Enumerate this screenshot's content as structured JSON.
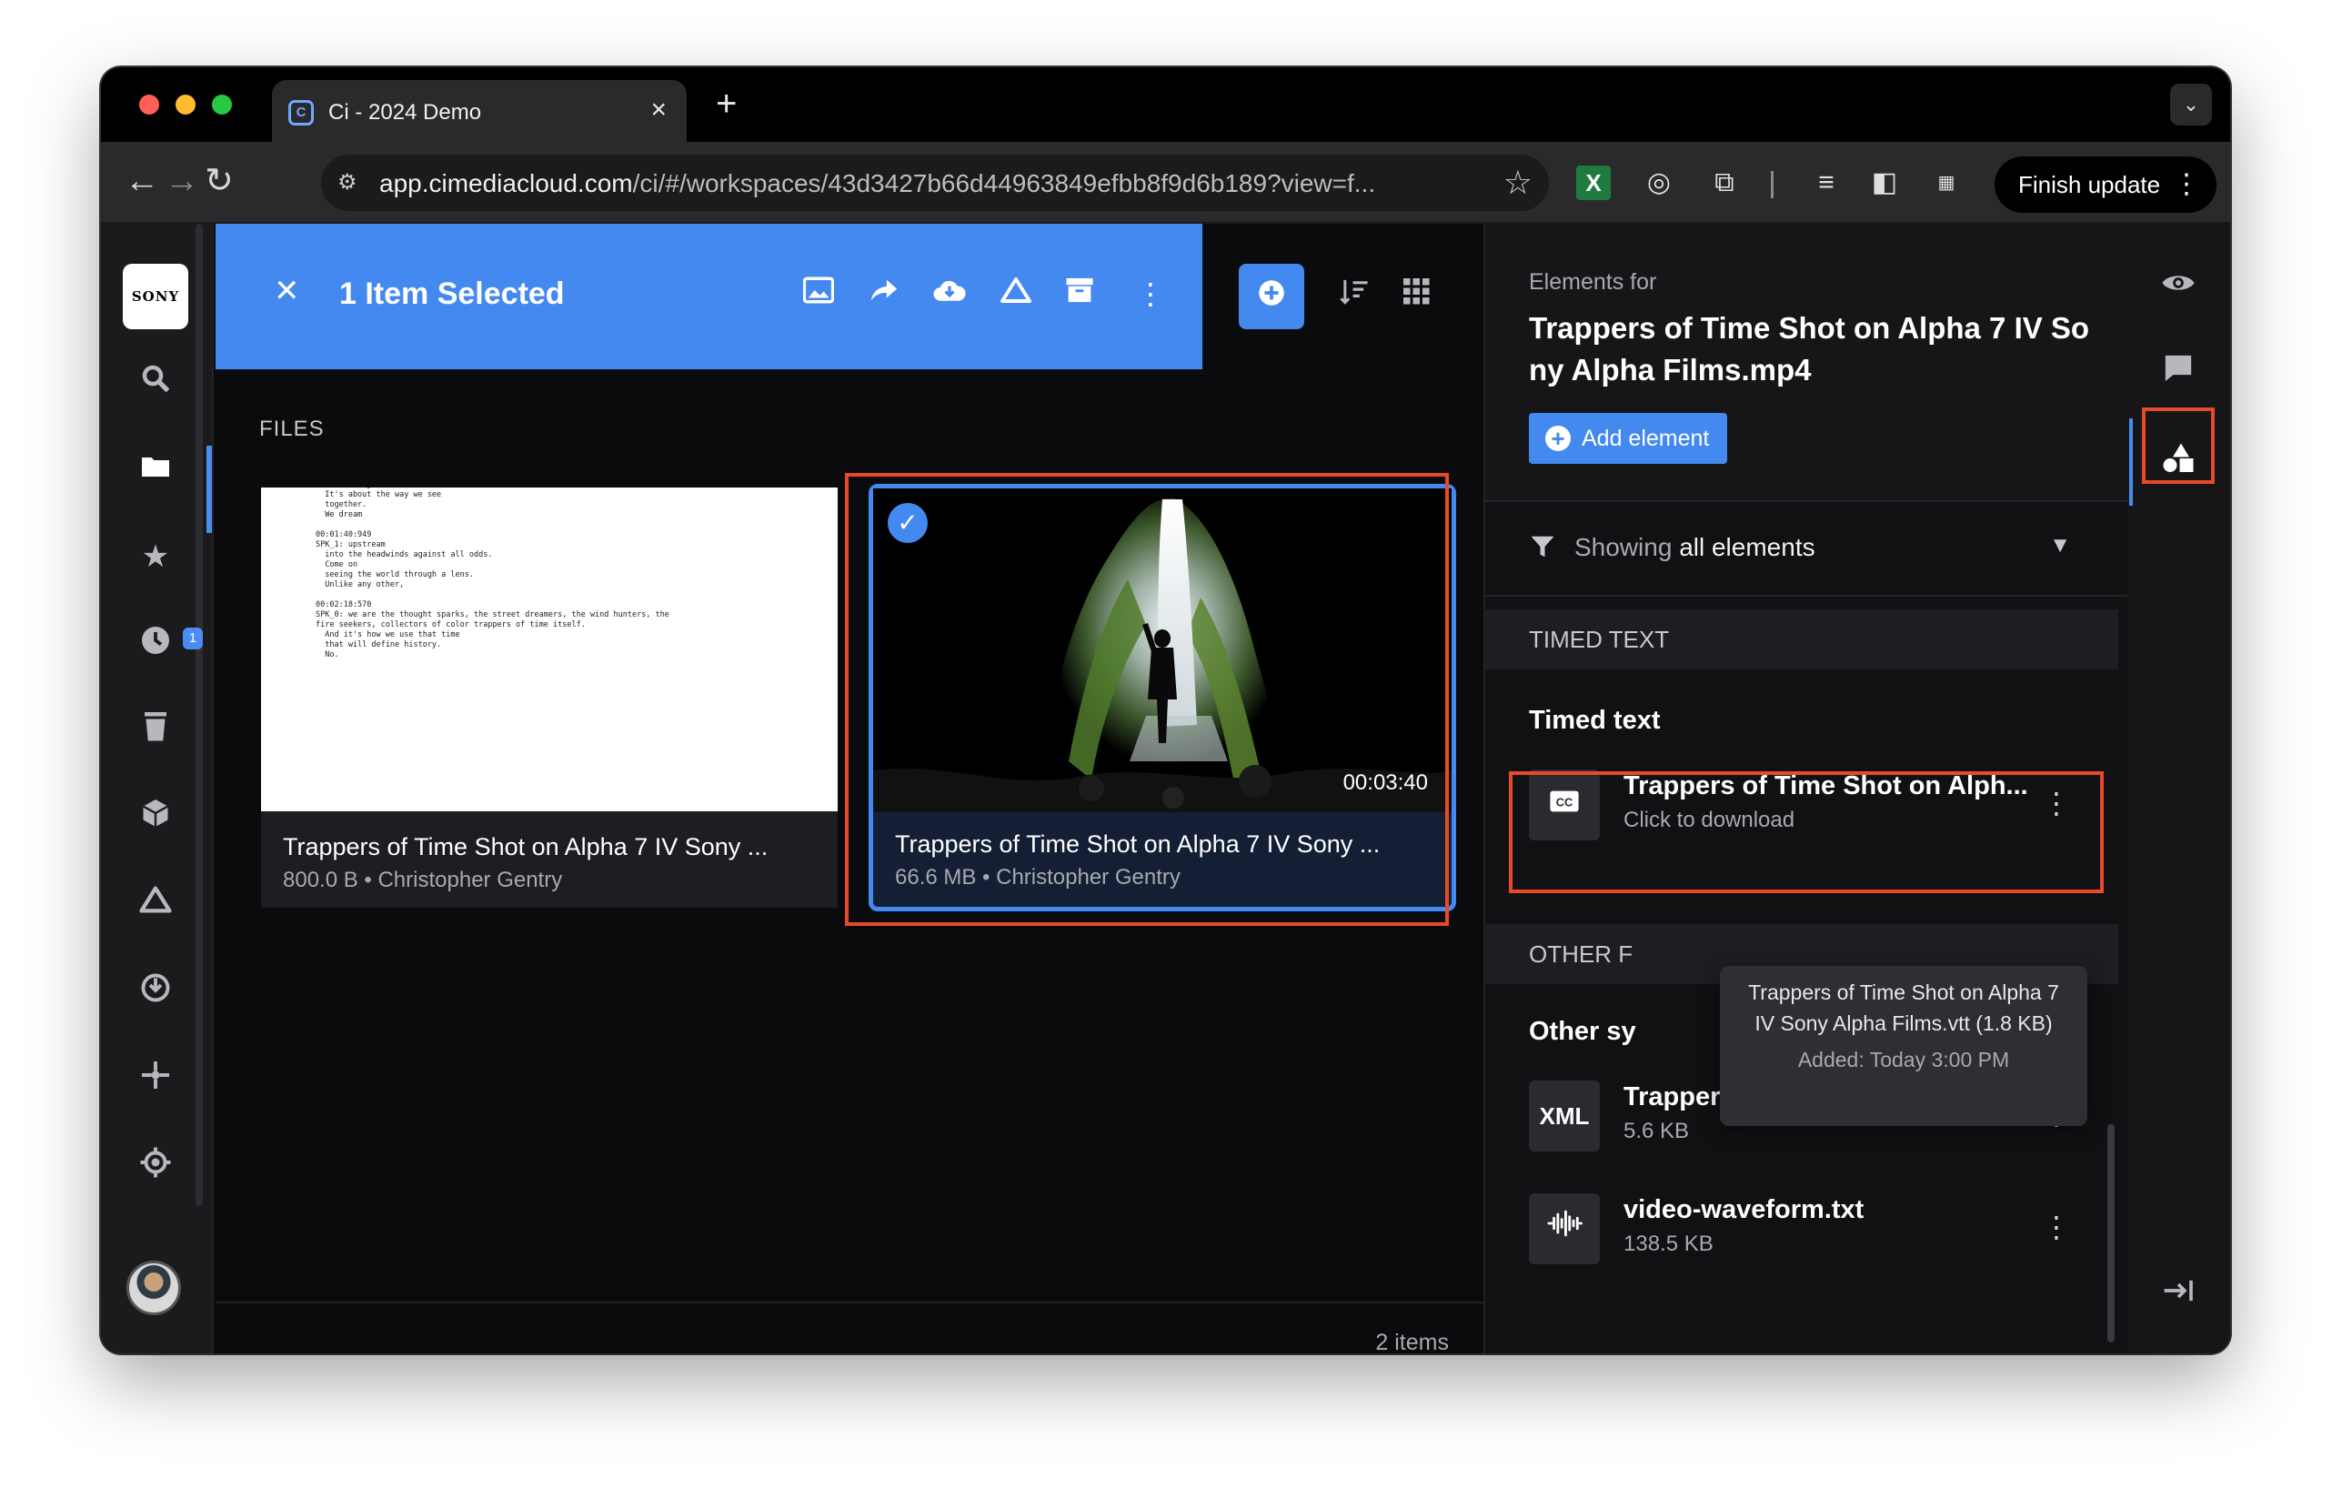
{
  "browser": {
    "tab_title": "Ci - 2024 Demo",
    "tab_favicon": "C",
    "url_domain": "app.cimediacloud.com",
    "url_path": "/ci/#/workspaces/43d3427b66d44963849efbb8f9d6b189?view=f...",
    "finish_update_label": "Finish update",
    "icons": [
      "back-icon",
      "forward-icon",
      "reload-icon",
      "site-settings-icon",
      "star-icon",
      "excel-extension-icon",
      "grammar-extension-icon",
      "puzzle-extension-icon",
      "media-control-icon",
      "sidepanel-icon",
      "sony-extension-icon"
    ]
  },
  "leftnav": {
    "logo_text": "SONY",
    "badge_count": "1",
    "items": [
      "search",
      "folder",
      "favorites",
      "recent",
      "trash",
      "package",
      "cloud",
      "download",
      "network",
      "settings"
    ]
  },
  "selection_bar": {
    "title": "1 Item Selected",
    "actions": [
      "image",
      "share",
      "download",
      "cloud",
      "archive",
      "more"
    ]
  },
  "main": {
    "section_label": "FILES",
    "item_count": "2 items",
    "cards": [
      {
        "title": "Trappers of Time Shot on Alpha 7 IV Sony ...",
        "meta": "800.0 B • Christopher Gentry",
        "thumb_text": "  It's not just about what we see.\n  It's about the way we see\n  together.\n  We dream\n\n00:01:40:949\nSPK_1: upstream\n  into the headwinds against all odds.\n  Come on\n  seeing the world through a lens.\n  Unlike any other,\n\n00:02:18:570\nSPK_0: we are the thought sparks, the street dreamers, the wind hunters, the\nfire seekers, collectors of color trappers of time itself.\n  And it's how we use that time\n  that will define history.\n  No."
      },
      {
        "title": "Trappers of Time Shot on Alpha 7 IV Sony ...",
        "meta": "66.6 MB • Christopher Gentry",
        "duration": "00:03:40",
        "selected": true
      }
    ]
  },
  "panel": {
    "heading": "Elements for",
    "file_name": "Trappers of Time Shot on Alpha 7 IV Sony Alpha Films.mp4",
    "add_label": "Add element",
    "filter_prefix": "Showing ",
    "filter_value": "all elements",
    "sections": {
      "timed_text": "TIMED TEXT",
      "other_prefix": "OTHER F"
    },
    "groups": {
      "timed_text": "Timed text",
      "other_prefix": "Other sy"
    },
    "elements": [
      {
        "icon": "CC",
        "name": "Trappers of Time Shot on Alph...",
        "sub": "Click to download"
      },
      {
        "icon": "XML",
        "name": "Trappers of Time Shot on Alph...",
        "sub": "5.6 KB"
      },
      {
        "icon": "waveform",
        "name": "video-waveform.txt",
        "sub": "138.5 KB"
      }
    ],
    "tooltip": {
      "text": "Trappers of Time Shot on Alpha 7 IV Sony Alpha Films.vtt (1.8 KB)",
      "added": "Added: Today 3:00 PM"
    }
  },
  "rail": {
    "items": [
      "preview",
      "comments",
      "elements",
      "collapse"
    ]
  },
  "colors": {
    "accent": "#4389f0",
    "highlight": "#e84a27",
    "background": "#0b0b0d"
  }
}
